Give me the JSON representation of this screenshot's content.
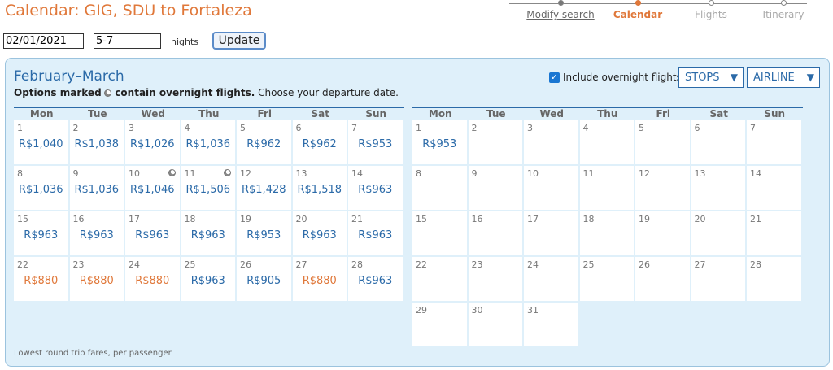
{
  "header": {
    "title": "Calendar: GIG, SDU to Fortaleza"
  },
  "progress": [
    {
      "label": "Modify search",
      "state": "link"
    },
    {
      "label": "Calendar",
      "state": "active"
    },
    {
      "label": "Flights",
      "state": "future"
    },
    {
      "label": "Itinerary",
      "state": "future"
    }
  ],
  "search": {
    "date": "02/01/2021",
    "nights": "5-7",
    "nights_label": "nights",
    "update_label": "Update"
  },
  "calendar": {
    "title": "February–March",
    "note_bold_a": "Options marked",
    "note_bold_b": "contain overnight flights.",
    "note_rest": "Choose your departure date.",
    "overnight_label": "Include overnight flights",
    "overnight_checked": true,
    "stops_label": "STOPS",
    "airline_label": "AIRLINE",
    "weekdays": [
      "Mon",
      "Tue",
      "Wed",
      "Thu",
      "Fri",
      "Sat",
      "Sun"
    ],
    "footer": "Lowest round trip fares, per passenger",
    "colors": {
      "accent": "#e0783a",
      "price": "#2b6aa8",
      "panel": "#dff0fa"
    },
    "february": [
      {
        "day": "1",
        "price": "R$1,040"
      },
      {
        "day": "2",
        "price": "R$1,038"
      },
      {
        "day": "3",
        "price": "R$1,026"
      },
      {
        "day": "4",
        "price": "R$1,036"
      },
      {
        "day": "5",
        "price": "R$962"
      },
      {
        "day": "6",
        "price": "R$962"
      },
      {
        "day": "7",
        "price": "R$953"
      },
      {
        "day": "8",
        "price": "R$1,036"
      },
      {
        "day": "9",
        "price": "R$1,036"
      },
      {
        "day": "10",
        "price": "R$1,046",
        "overnight": true
      },
      {
        "day": "11",
        "price": "R$1,506",
        "overnight": true
      },
      {
        "day": "12",
        "price": "R$1,428"
      },
      {
        "day": "13",
        "price": "R$1,518"
      },
      {
        "day": "14",
        "price": "R$963"
      },
      {
        "day": "15",
        "price": "R$963"
      },
      {
        "day": "16",
        "price": "R$963"
      },
      {
        "day": "17",
        "price": "R$963"
      },
      {
        "day": "18",
        "price": "R$963"
      },
      {
        "day": "19",
        "price": "R$953"
      },
      {
        "day": "20",
        "price": "R$963"
      },
      {
        "day": "21",
        "price": "R$963"
      },
      {
        "day": "22",
        "price": "R$880",
        "lowest": true
      },
      {
        "day": "23",
        "price": "R$880",
        "lowest": true
      },
      {
        "day": "24",
        "price": "R$880",
        "lowest": true
      },
      {
        "day": "25",
        "price": "R$963"
      },
      {
        "day": "26",
        "price": "R$905"
      },
      {
        "day": "27",
        "price": "R$880",
        "lowest": true
      },
      {
        "day": "28",
        "price": "R$963"
      }
    ],
    "march": [
      {
        "day": "1",
        "price": "R$953"
      },
      {
        "day": "2"
      },
      {
        "day": "3"
      },
      {
        "day": "4"
      },
      {
        "day": "5"
      },
      {
        "day": "6"
      },
      {
        "day": "7"
      },
      {
        "day": "8"
      },
      {
        "day": "9"
      },
      {
        "day": "10"
      },
      {
        "day": "11"
      },
      {
        "day": "12"
      },
      {
        "day": "13"
      },
      {
        "day": "14"
      },
      {
        "day": "15"
      },
      {
        "day": "16"
      },
      {
        "day": "17"
      },
      {
        "day": "18"
      },
      {
        "day": "19"
      },
      {
        "day": "20"
      },
      {
        "day": "21"
      },
      {
        "day": "22"
      },
      {
        "day": "23"
      },
      {
        "day": "24"
      },
      {
        "day": "25"
      },
      {
        "day": "26"
      },
      {
        "day": "27"
      },
      {
        "day": "28"
      },
      {
        "day": "29"
      },
      {
        "day": "30"
      },
      {
        "day": "31"
      }
    ]
  }
}
